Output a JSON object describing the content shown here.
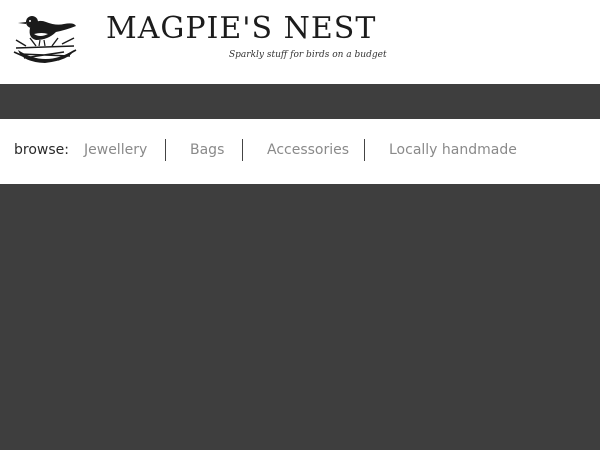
{
  "header": {
    "brand_name": "MAGPIE'S NEST",
    "tagline": "Sparkly stuff for birds on a budget",
    "logo_icon": "magpie-on-nest-icon"
  },
  "browse": {
    "label": "browse:",
    "links": [
      {
        "label": "Jewellery"
      },
      {
        "label": "Bags"
      },
      {
        "label": "Accessories"
      },
      {
        "label": "Locally handmade"
      }
    ]
  },
  "colors": {
    "background": "#3e3e3e",
    "panel": "#ffffff",
    "link": "#8a8a8a",
    "text": "#2a2a2a"
  }
}
